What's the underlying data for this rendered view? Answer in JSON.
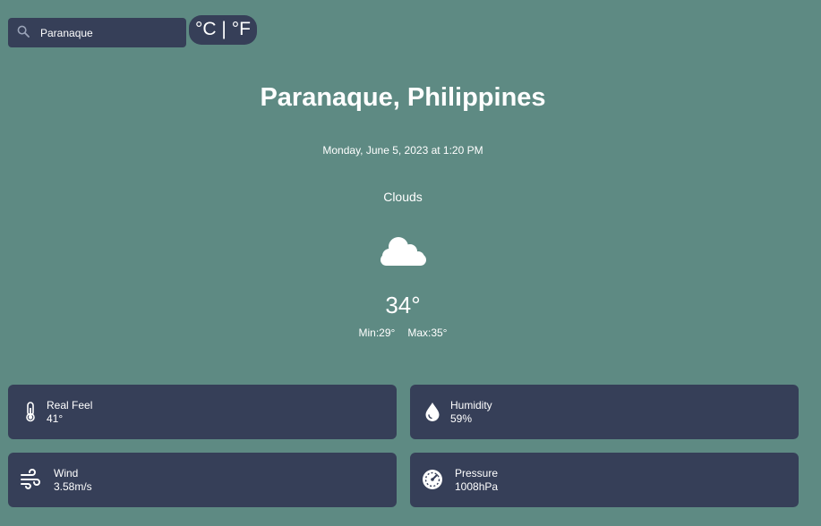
{
  "search": {
    "value": "Paranaque",
    "icon": "search-icon"
  },
  "unit_toggle": {
    "label": "°C | °F"
  },
  "location": {
    "title": "Paranaque, Philippines"
  },
  "datetime": "Monday, June 5, 2023 at 1:20 PM",
  "condition": "Clouds",
  "weather_icon": "cloud-icon",
  "temperature": "34°",
  "min": "Min:29°",
  "max": "Max:35°",
  "cards": [
    {
      "title": "Real Feel",
      "value": "41°",
      "icon": "thermometer-icon"
    },
    {
      "title": "Humidity",
      "value": "59%",
      "icon": "water-drop-icon"
    },
    {
      "title": "Wind",
      "value": "3.58m/s",
      "icon": "wind-icon"
    },
    {
      "title": "Pressure",
      "value": "1008hPa",
      "icon": "gauge-icon"
    }
  ],
  "colors": {
    "background": "#5e8a83",
    "panel": "#363f58",
    "text": "#ffffff"
  }
}
